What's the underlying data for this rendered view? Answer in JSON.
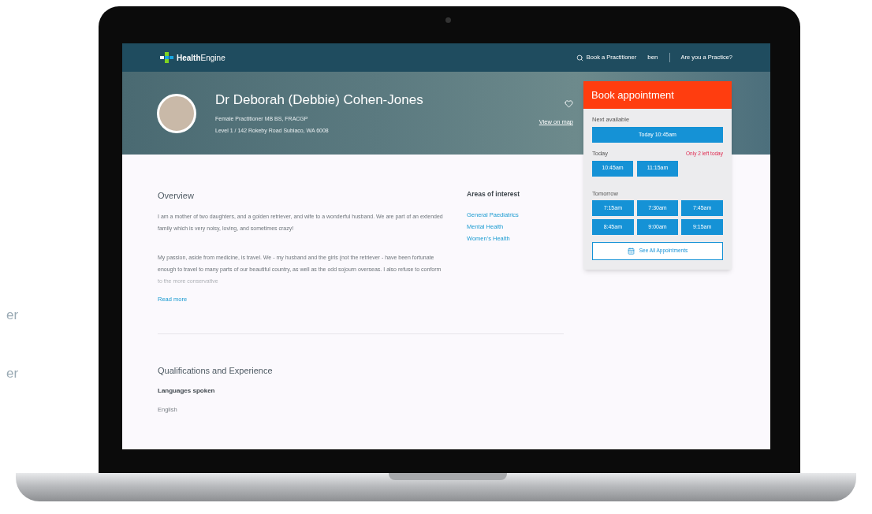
{
  "side_text": [
    "er",
    "er"
  ],
  "nav": {
    "logo": "**Health**Engine",
    "links": [
      {
        "label": "Book a Practitioner",
        "kind": "search"
      },
      {
        "label": "ben",
        "kind": "user"
      },
      {
        "label": "Are you a Practice?",
        "kind": "plain"
      }
    ]
  },
  "profile": {
    "name": "Dr Deborah (Debbie) Cohen-Jones",
    "subtitle": "Female Practitioner MB BS, FRACGP",
    "address": "Level 1 / 142 Rokeby Road Subiaco, WA 6008",
    "map_link": "View on map"
  },
  "booking": {
    "title": "Book appointment",
    "next_label": "Next available",
    "next_slot": "Today 10:45am",
    "today_label": "Today",
    "today_note": "Only 2 left today",
    "today_slots": [
      "10:45am",
      "11:15am"
    ],
    "tomorrow_label": "Tomorrow",
    "tomorrow_slots": [
      "7:15am",
      "7:30am",
      "7:45am",
      "8:45am",
      "9:00am",
      "9:15am"
    ],
    "see_all": "See All Appointments"
  },
  "overview": {
    "title": "Overview",
    "paragraphs": [
      "I am a mother of two daughters, and a golden retriever, and wife to a wonderful husband. We are part of an extended family which is very noisy, loving, and sometimes crazy!",
      "My passion, aside from medicine, is travel. We - my husband and the girls (not the retriever - have been fortunate enough to travel to many parts of our beautiful country, as well as the odd sojourn overseas. I also refuse to conform to the more conservative"
    ],
    "read_more": "Read more"
  },
  "areas": {
    "title": "Areas of interest",
    "items": [
      "General Paediatrics",
      "Mental Health",
      "Women's Health"
    ]
  },
  "qualifications": {
    "title": "Qualifications and Experience",
    "languages_label": "Languages spoken",
    "languages": "English"
  }
}
